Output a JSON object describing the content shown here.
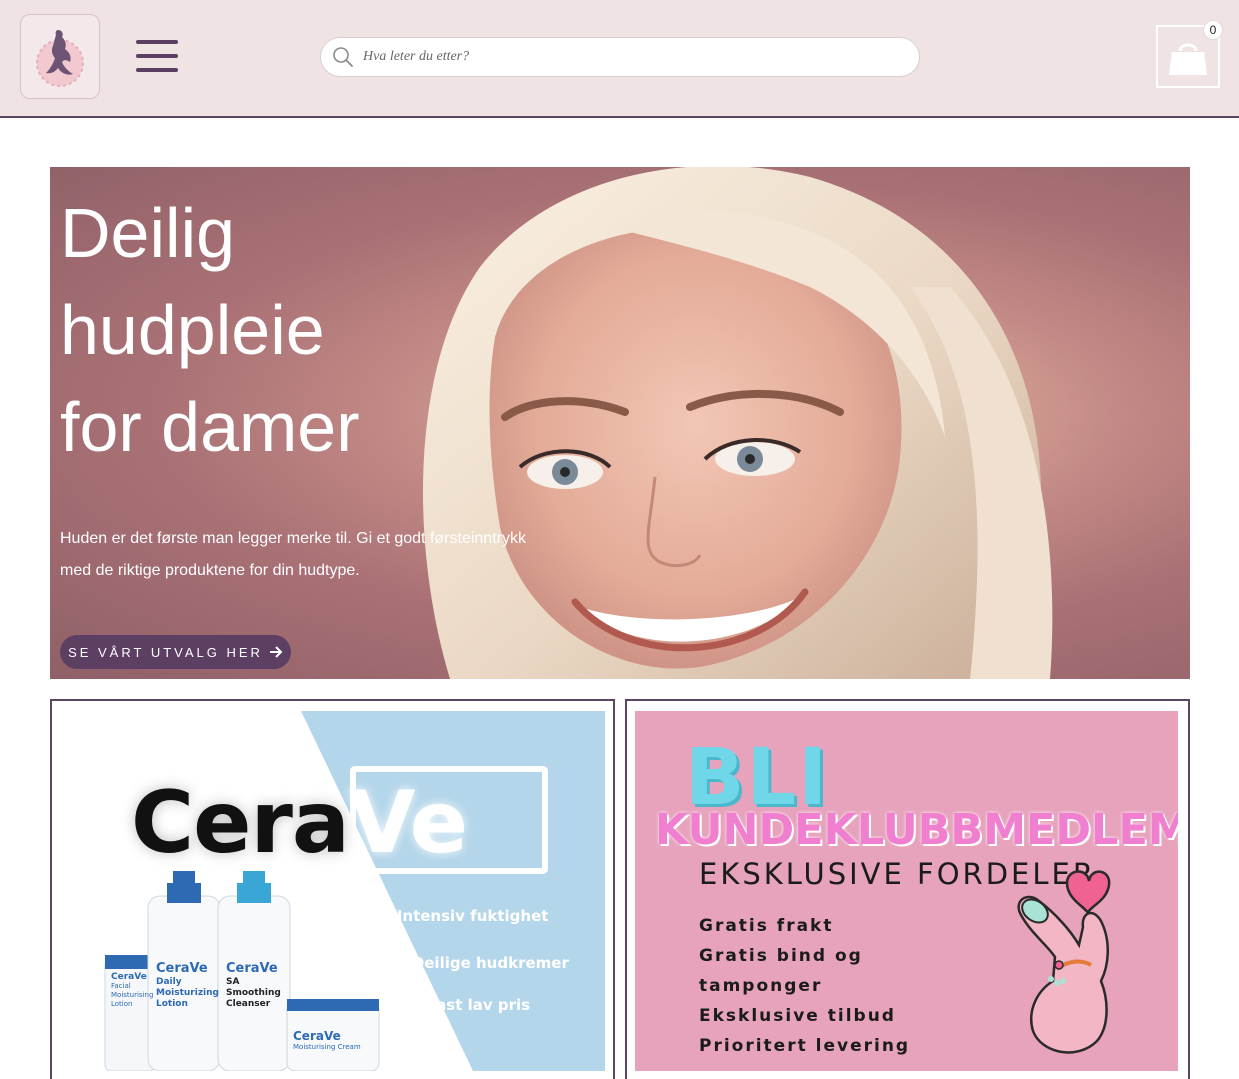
{
  "header": {
    "logo_icon": "woman-silhouette-logo-icon",
    "menu_icon": "hamburger-menu-icon",
    "search": {
      "placeholder": "Hva leter du etter?",
      "icon": "search-icon"
    },
    "cart": {
      "icon": "shopping-bag-icon",
      "count": "0"
    }
  },
  "hero": {
    "title_lines": [
      "Deilig",
      "hudpleie",
      "for damer"
    ],
    "text_line_1": "Huden er det første man legger merke til. Gi et godt førsteinntrykk",
    "text_line_2": "med de riktige produktene for din hudtype.",
    "button_label": "SE VÅRT UTVALG HER",
    "button_icon": "arrow-right-icon"
  },
  "promo_left": {
    "brand_part_1": "Cera",
    "brand_part_2": "Ve",
    "bullets": [
      "Intensiv fuktighet",
      "Deilige hudkremer",
      "Fast lav pris"
    ],
    "products": [
      {
        "line1": "CeraVe",
        "line2": "Facial",
        "line3": "Moisturising",
        "line4": "Lotion"
      },
      {
        "line1": "CeraVe",
        "line2": "Daily",
        "line3": "Moisturizing",
        "line4": "Lotion"
      },
      {
        "line1": "CeraVe",
        "line2": "SA Smoothing",
        "line3": "Cleanser",
        "line4": ""
      },
      {
        "line1": "CeraVe",
        "line2": "Moisturising Cream",
        "line3": "",
        "line4": ""
      }
    ]
  },
  "promo_right": {
    "title_1": "BLI",
    "title_2": "KUNDEKLUBBMEDLEM",
    "subtitle": "EKSKLUSIVE FORDELER",
    "perks": [
      "Gratis frakt",
      "Gratis bind og",
      "tamponger",
      "Eksklusive tilbud",
      "Prioritert levering"
    ],
    "icon": "heart-hand-icon"
  },
  "colors": {
    "header_bg": "#f0e3e4",
    "accent": "#5c3f63",
    "klubb_bg": "#e6a3bb",
    "cerave_blue": "#b4d6ea"
  }
}
